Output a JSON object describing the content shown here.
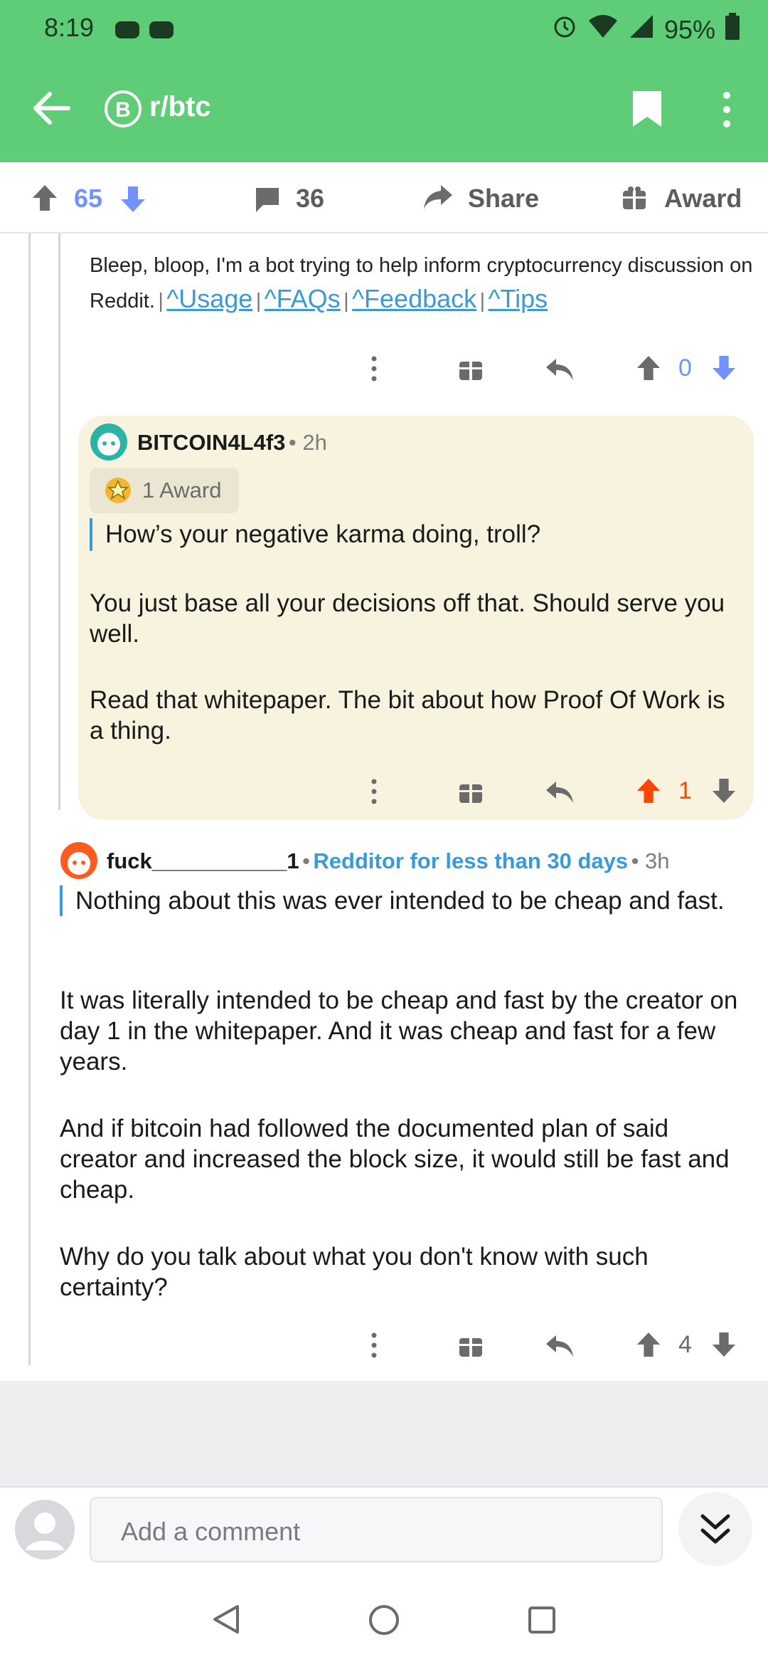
{
  "status_bar": {
    "time": "8:19",
    "battery": "95%"
  },
  "app_bar": {
    "subreddit": "r/btc"
  },
  "post_actions": {
    "score": "65",
    "comments": "36",
    "share_label": "Share",
    "award_label": "Award"
  },
  "bot_comment": {
    "text": "Bleep, bloop, I'm a bot trying to help inform cryptocurrency discussion on Reddit.",
    "links": [
      "^Usage",
      "^FAQs",
      "^Feedback",
      "^Tips"
    ],
    "separator": "|",
    "score": "0"
  },
  "highlighted_comment": {
    "author": "BITCOIN4L4f3",
    "time": "• 2h",
    "award_label": "1 Award",
    "quote": "How’s your negative karma doing, troll?",
    "paragraphs": [
      "You just base all your decisions off that. Should serve you well.",
      "Read that whitepaper. The bit about how Proof Of Work is a thing."
    ],
    "score": "1"
  },
  "reply_comment": {
    "author": "fuck___________1",
    "flair": "Redditor for less than 30 days",
    "dot": "•",
    "time": "• 3h",
    "quote": "Nothing about this was ever intended to be cheap and fast.",
    "paragraphs": [
      "It was literally intended to be cheap and fast by the creator on day 1 in the whitepaper. And it was cheap and fast for a few years.",
      "And if bitcoin had followed the documented plan of said creator and increased the block size, it would still be fast and cheap.",
      "Why do you talk about what you don't know with such certainty?"
    ],
    "score": "4"
  },
  "composer": {
    "placeholder": "Add a comment"
  },
  "colors": {
    "app_bar": "#5fcc77",
    "upvote_active": "#ff4500",
    "downvote": "#7193ff",
    "link": "#3a9ad9",
    "highlight_bg": "#f7f3df"
  },
  "icons": [
    "back-arrow-icon",
    "bitcoin-icon",
    "bookmark-icon",
    "more-vert-icon",
    "upvote-icon",
    "downvote-icon",
    "comment-icon",
    "share-icon",
    "gift-icon",
    "reply-icon",
    "alarm-icon",
    "wifi-icon",
    "signal-icon",
    "battery-icon",
    "avatar-icon",
    "chevron-double-down-icon",
    "nav-back-icon",
    "nav-home-icon",
    "nav-recents-icon"
  ]
}
